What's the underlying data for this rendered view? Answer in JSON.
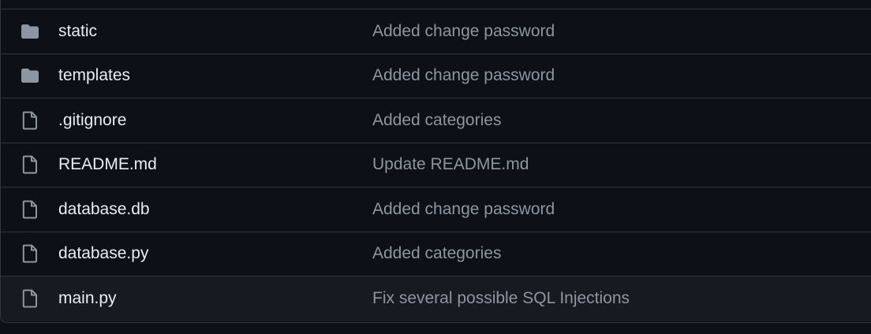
{
  "files": [
    {
      "icon": "folder-icon",
      "name": "static",
      "commit": "Added change password"
    },
    {
      "icon": "folder-icon",
      "name": "templates",
      "commit": "Added change password"
    },
    {
      "icon": "file-icon",
      "name": ".gitignore",
      "commit": "Added categories"
    },
    {
      "icon": "file-icon",
      "name": "README.md",
      "commit": "Update README.md"
    },
    {
      "icon": "file-icon",
      "name": "database.db",
      "commit": "Added change password"
    },
    {
      "icon": "file-icon",
      "name": "database.py",
      "commit": "Added categories"
    },
    {
      "icon": "file-icon",
      "name": "main.py",
      "commit": "Fix several possible SQL Injections"
    }
  ],
  "colors": {
    "background": "#0d1117",
    "row_hover": "#161b22",
    "border": "#30363d",
    "name_text": "#e6edf3",
    "commit_text": "#8d96a0",
    "icon": "#8d96a0"
  }
}
